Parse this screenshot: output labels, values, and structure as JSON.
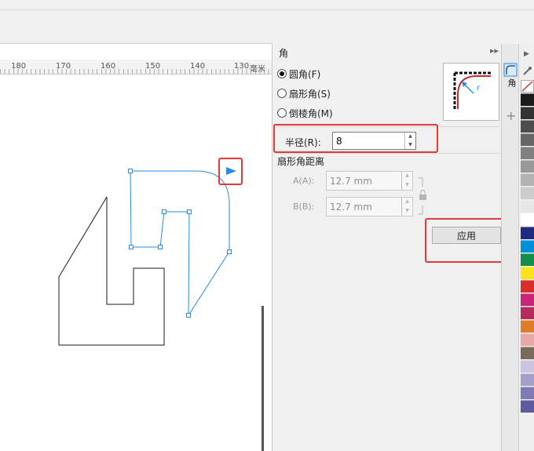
{
  "ruler": {
    "labels": [
      "180",
      "170",
      "160",
      "150",
      "140",
      "130",
      "毫米"
    ]
  },
  "panel": {
    "title": "角",
    "options": [
      {
        "label": "圆角(F)",
        "checked": true
      },
      {
        "label": "扇形角(S)",
        "checked": false
      },
      {
        "label": "倒棱角(M)",
        "checked": false
      }
    ],
    "radius_label": "半径(R):",
    "radius_value": "8",
    "scallop_distance_label": "扇形角距离",
    "field_a_label": "A(A):",
    "field_a_value": "12.7 mm",
    "field_b_label": "B(B):",
    "field_b_value": "12.7 mm",
    "apply_label": "应用"
  },
  "colors": {
    "highlight": "#e03a3a",
    "selection": "#2a8be0",
    "palette": [
      "#ffffff",
      "#1a1a1a",
      "#333333",
      "#4d4d4d",
      "#666666",
      "#808080",
      "#999999",
      "#b3b3b3",
      "#cccccc",
      "#e6e6e6",
      "#ffffff",
      "#1f2a80",
      "#0090d8",
      "#12904a",
      "#ffe21a",
      "#d72d2d",
      "#c8247a",
      "#b52c5c",
      "#e07b2a",
      "#e8a8a8",
      "#7a6a5a",
      "#c9c3e0",
      "#a4a0cc",
      "#7f7ab4",
      "#5e5aa0"
    ]
  }
}
